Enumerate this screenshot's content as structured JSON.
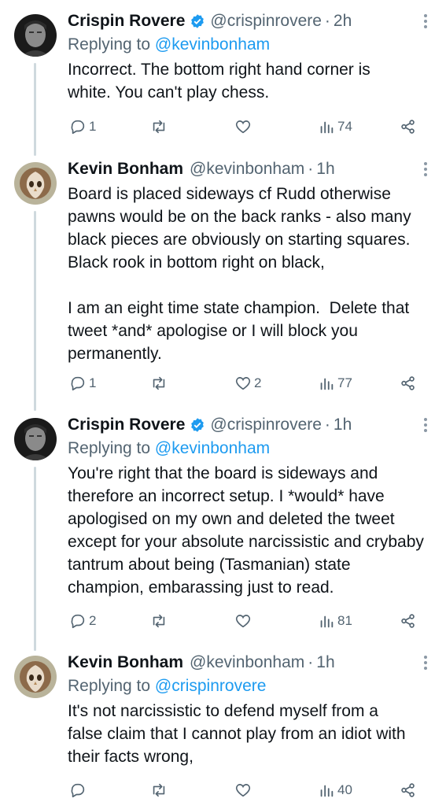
{
  "tweets": [
    {
      "name": "Crispin Rovere",
      "verified": true,
      "handle": "@crispinrovere",
      "time": "2h",
      "reply_prefix": "Replying to",
      "reply_to": "@kevinbonham",
      "text": "Incorrect. The bottom right hand corner is white. You can't play chess.",
      "replies": "1",
      "retweets": "",
      "likes": "",
      "views": "74"
    },
    {
      "name": "Kevin Bonham",
      "verified": false,
      "handle": "@kevinbonham",
      "time": "1h",
      "reply_prefix": "",
      "reply_to": "",
      "text": "Board is placed sideways cf Rudd otherwise pawns would be on the back ranks - also many black pieces are obviously on starting squares.  Black rook in bottom right on black,\n\nI am an eight time state champion.  Delete that tweet *and* apologise or I will block you permanently.",
      "replies": "1",
      "retweets": "",
      "likes": "2",
      "views": "77"
    },
    {
      "name": "Crispin Rovere",
      "verified": true,
      "handle": "@crispinrovere",
      "time": "1h",
      "reply_prefix": "Replying to",
      "reply_to": "@kevinbonham",
      "text": "You're right that the board is sideways and therefore an incorrect setup. I *would* have apologised on my own and deleted the tweet except for your absolute narcissistic and crybaby tantrum about being (Tasmanian) state champion, embarassing just to read.",
      "replies": "2",
      "retweets": "",
      "likes": "",
      "views": "81"
    },
    {
      "name": "Kevin Bonham",
      "verified": false,
      "handle": "@kevinbonham",
      "time": "1h",
      "reply_prefix": "Replying to",
      "reply_to": "@crispinrovere",
      "text": "It's not narcissistic to defend myself from a false claim that I cannot play from an idiot with their facts wrong,",
      "replies": "",
      "retweets": "",
      "likes": "",
      "views": "40"
    }
  ],
  "icons": {
    "reply": "reply-icon",
    "retweet": "retweet-icon",
    "like": "heart-icon",
    "views": "views-icon",
    "share": "share-icon",
    "more": "more-icon",
    "verified": "verified-badge-icon"
  },
  "colors": {
    "link": "#1d9bf0",
    "secondary": "#536471",
    "thread_line": "#cfd9de",
    "verified": "#1d9bf0"
  }
}
